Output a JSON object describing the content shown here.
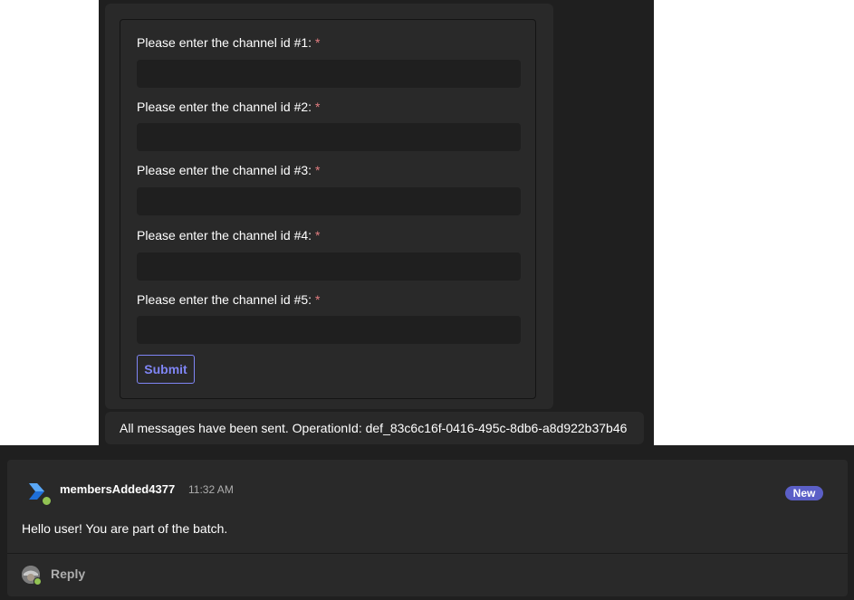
{
  "card": {
    "fields": [
      {
        "label": "Please enter the channel id #1:",
        "required_mark": "*",
        "value": ""
      },
      {
        "label": "Please enter the channel id #2:",
        "required_mark": "*",
        "value": ""
      },
      {
        "label": "Please enter the channel id #3:",
        "required_mark": "*",
        "value": ""
      },
      {
        "label": "Please enter the channel id #4:",
        "required_mark": "*",
        "value": ""
      },
      {
        "label": "Please enter the channel id #5:",
        "required_mark": "*",
        "value": ""
      }
    ],
    "submit_label": "Submit"
  },
  "status_message": "All messages have been sent. OperationId: def_83c6c16f-0416-495c-8db6-a8d922b37b46",
  "post": {
    "author": "membersAdded4377",
    "time": "11:32 AM",
    "badge": "New",
    "message": "Hello user! You are part of the batch.",
    "reply_label": "Reply",
    "avatar_icon": "bot-app-icon",
    "presence": "available"
  },
  "colors": {
    "accent": "#7f85f5",
    "badge": "#5b5fc7",
    "required": "#e37d80",
    "presence_available": "#92c353"
  }
}
